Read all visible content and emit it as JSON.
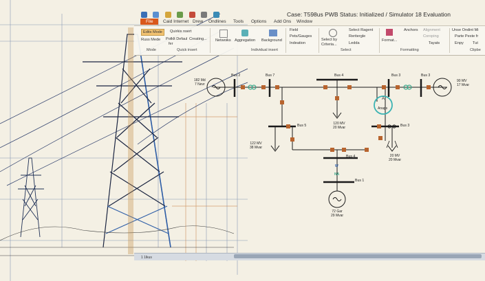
{
  "window": {
    "title": "Case: T598us PWB  Status: Initialized / Simulator 18 Evaluation"
  },
  "tabs": [
    {
      "label": "File"
    },
    {
      "label": "Caid Internet"
    },
    {
      "label": "Drew"
    },
    {
      "label": "Ondlines"
    },
    {
      "label": "Tools"
    },
    {
      "label": "Options"
    },
    {
      "label": "Add Ons"
    },
    {
      "label": "Window"
    }
  ],
  "ribbon": {
    "edit_mode": "Edits Mode",
    "run_mode": "Russ Mede",
    "quick_insert_menu": "Quirkis nsert",
    "polklt_defaul": "Polklt Defaul",
    "for": "fer",
    "creating": "Creating...",
    "network": "Netwoiks",
    "aggregation": "Aggregation",
    "background": "Background",
    "field": "Field",
    "pets_gauges": "Pets/Gauges",
    "indeation": "Indeation",
    "select_by_criteria": "Select by Criteria...",
    "select_regent": "Select Ragent",
    "rectangle": "Reritergle",
    "lasso": "Ledda",
    "format": "Format...",
    "anchors": "Anchors",
    "alignment": "Alignment",
    "grouping": "Coroping",
    "layers": "Tayats",
    "unse_ondint": "Unse Ondint Mi",
    "parte_peste": "Parte Peste fr",
    "enpy": "Enpy",
    "tut": "Tut",
    "groups": {
      "mode": "Mode",
      "quick_insert": "Quick insert",
      "individual_insert": "Individual insert",
      "select": "Select",
      "formatting": "Formatting",
      "clipboard": "Clipbe"
    }
  },
  "diagram": {
    "buses": {
      "bus2": "Bus 2",
      "bus7": "Bus 7",
      "bus4": "Bus 4",
      "bus3a": "Bus 3",
      "bus3b": "Bus 3",
      "bus5": "Bus 5",
      "bus3c": "Bus 3",
      "bus4b": "Bus 4",
      "bus1": "Bus 1"
    },
    "gen_left": [
      "182 Md",
      "7 Nevr"
    ],
    "gen_right": [
      "90 MV",
      "17 Mvar"
    ],
    "load_center": [
      "120 MV",
      "20 Mvar"
    ],
    "load_left": [
      "122 MV",
      "38 Mvar"
    ],
    "load_right": [
      "20 MV",
      "20 Mvar"
    ],
    "gen_bottom": [
      "72 Gar",
      "29 Mvar"
    ],
    "amps_label": "Anaps",
    "amps_letter": "A",
    "flow_mark_a": "W",
    "flow_mark_b": "NA"
  },
  "status": {
    "left": "1 1lkus"
  },
  "colors": {
    "bus": "#1a1a1a",
    "breaker": "#b8642e",
    "transformer": "#3aa88a",
    "highlight": "#3bb3b3",
    "file_tab": "#d9581b",
    "blueprint": "#2f4f8f",
    "paper": "#f4f0e4"
  }
}
